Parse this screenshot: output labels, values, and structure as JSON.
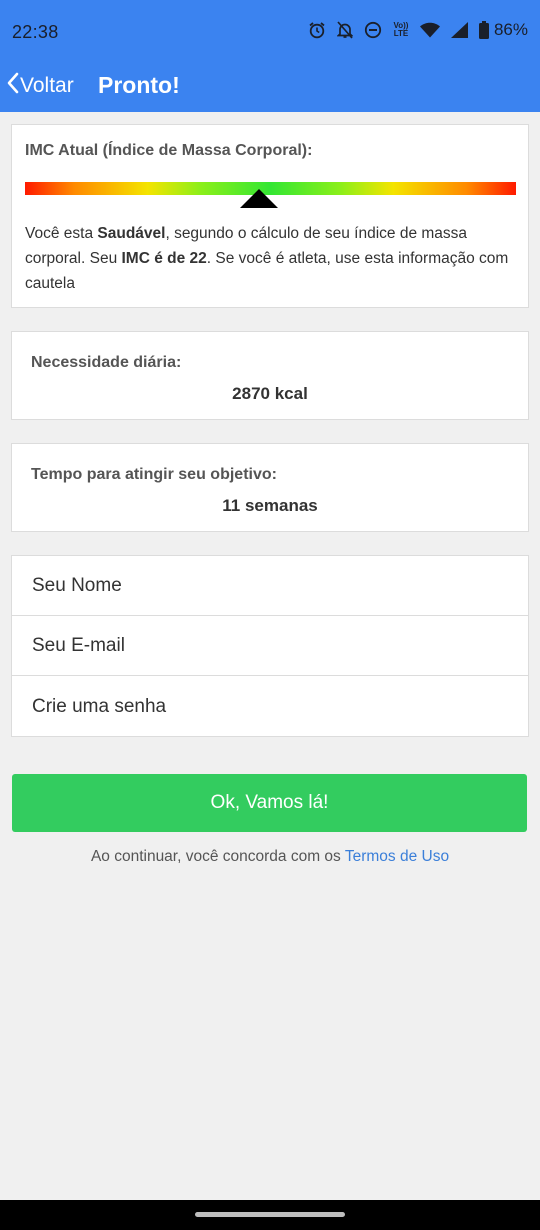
{
  "status_bar": {
    "time": "22:38",
    "battery_percent": "86%",
    "volte_label": "Vo)) LTE",
    "icons": [
      "alarm-icon",
      "notifications-off-icon",
      "do-not-disturb-icon",
      "volte-icon",
      "wifi-icon",
      "signal-icon",
      "battery-icon"
    ]
  },
  "header": {
    "back_label": "Voltar",
    "title": "Pronto!",
    "color": "#3b83f0"
  },
  "imc": {
    "title": "IMC Atual (Índice de Massa Corporal):",
    "text_prefix": "Você esta ",
    "status": "Saudável",
    "text_middle": ", segundo o cálculo de seu índice de massa corporal. Seu ",
    "imc_label": "IMC é de 22",
    "text_suffix": ". Se você é atleta, use esta informação com cautela"
  },
  "daily_need": {
    "label": "Necessidade diária:",
    "value": "2870 kcal"
  },
  "goal_time": {
    "label": "Tempo para atingir seu objetivo:",
    "value": "11 semanas"
  },
  "form": {
    "name_placeholder": "Seu Nome",
    "email_placeholder": "Seu E-mail",
    "password_placeholder": "Crie uma senha"
  },
  "cta": {
    "label": "Ok, Vamos lá!",
    "color": "#33cc5f"
  },
  "terms": {
    "prefix": "Ao continuar, você concorda com os ",
    "link": "Termos de Uso"
  }
}
